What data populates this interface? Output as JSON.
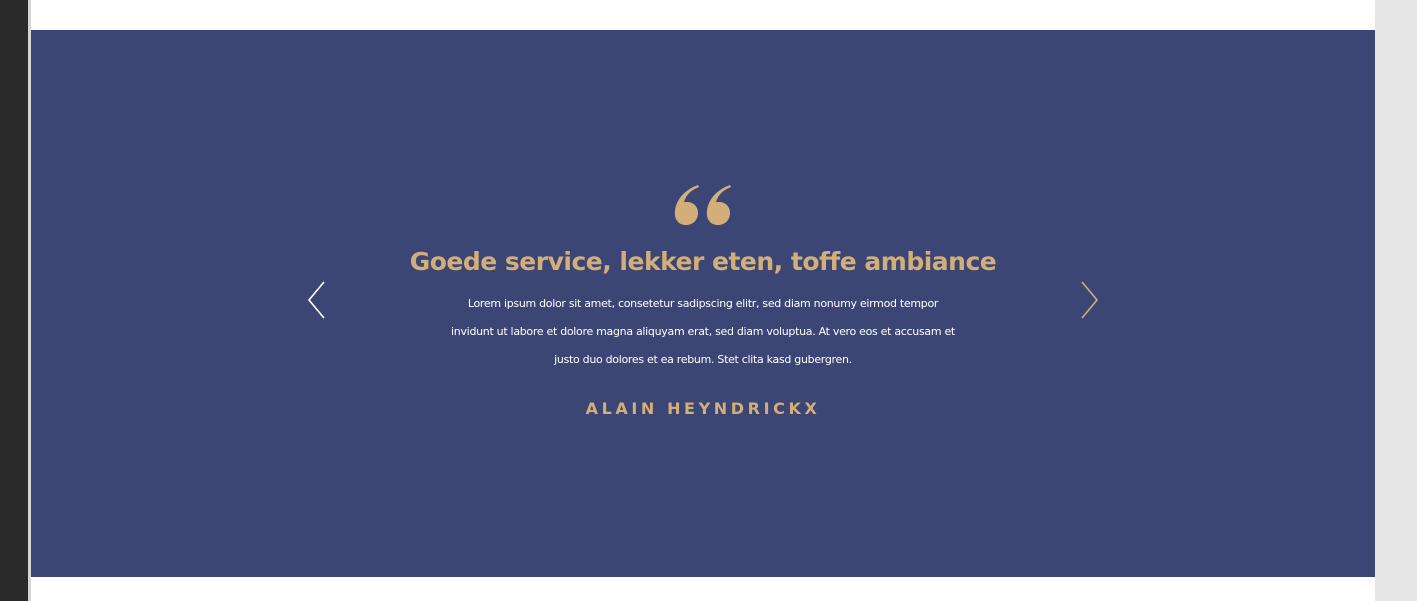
{
  "testimonial": {
    "quote_icon": "quote-icon",
    "headline": "Goede service, lekker eten, toffe ambiance",
    "body_lines": [
      "Lorem ipsum dolor sit amet, consetetur sadipscing elitr, sed diam nonumy eirmod tempor",
      "invidunt ut labore et dolore magna aliquyam erat, sed diam voluptua. At vero eos et accusam et",
      "justo duo  dolores et ea rebum. Stet clita kasd gubergren."
    ],
    "author": "ALAIN HEYNDRICKX",
    "prev_icon": "chevron-left-icon",
    "next_icon": "chevron-right-icon"
  },
  "colors": {
    "section_background": "#3b4674",
    "accent_gold": "#d4ae79",
    "body_text": "#ffffff",
    "prev_arrow": "#ffffff",
    "next_arrow": "#d4ae79",
    "left_strip": "#2a2a2a",
    "right_strip": "#e6e6e6"
  }
}
